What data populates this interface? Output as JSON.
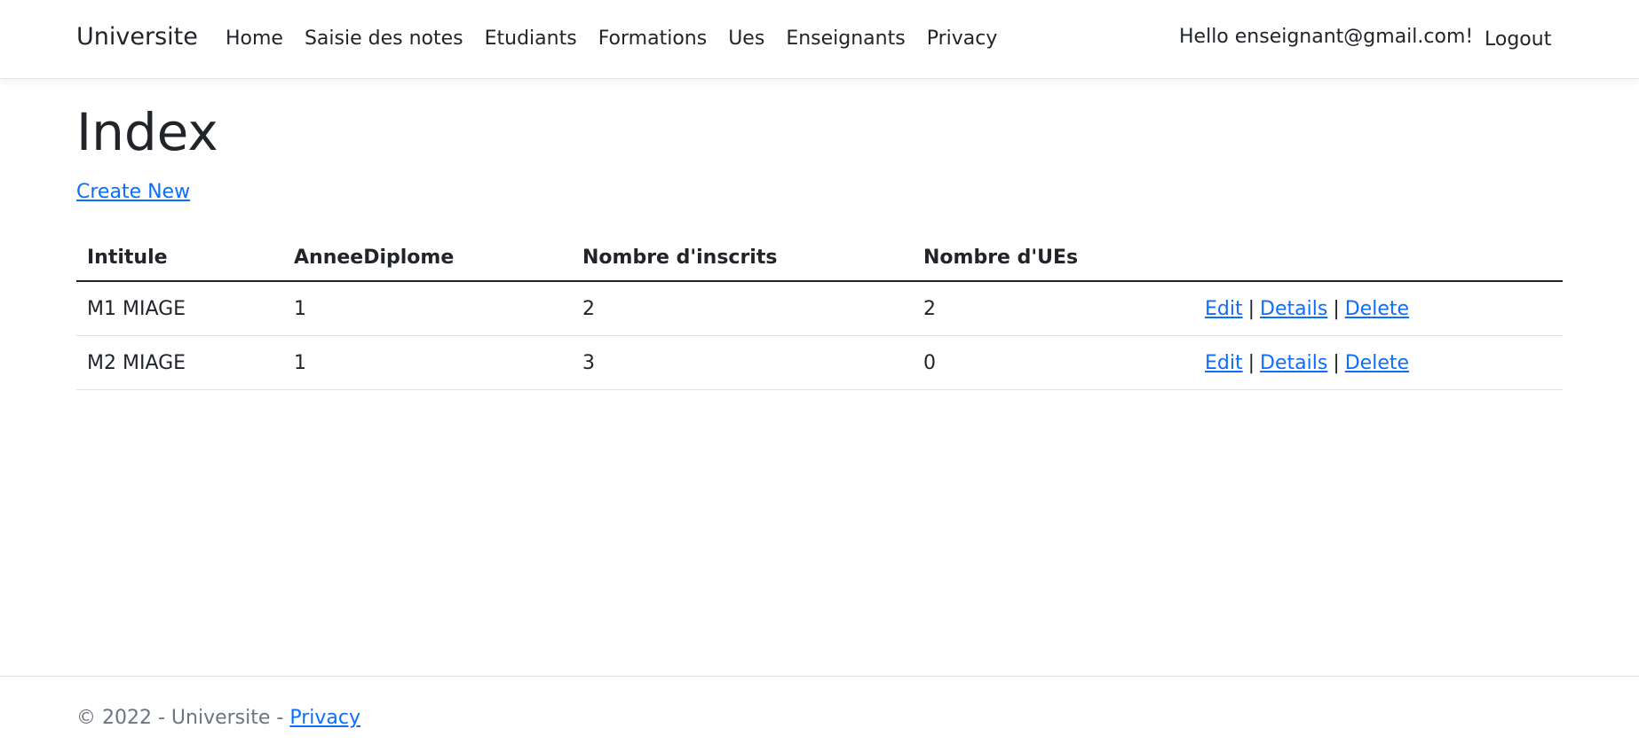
{
  "navbar": {
    "brand": "Universite",
    "links": [
      "Home",
      "Saisie des notes",
      "Etudiants",
      "Formations",
      "Ues",
      "Enseignants",
      "Privacy"
    ],
    "hello": "Hello enseignant@gmail.com!",
    "logout": "Logout"
  },
  "main": {
    "title": "Index",
    "create_new": "Create New",
    "table": {
      "headers": [
        "Intitule",
        "AnneeDiplome",
        "Nombre d'inscrits",
        "Nombre d'UEs",
        ""
      ],
      "rows": [
        {
          "intitule": "M1 MIAGE",
          "annee": "1",
          "inscrits": "2",
          "ues": "2"
        },
        {
          "intitule": "M2 MIAGE",
          "annee": "1",
          "inscrits": "3",
          "ues": "0"
        }
      ],
      "actions": {
        "edit": "Edit",
        "details": "Details",
        "delete": "Delete",
        "separator": "|"
      }
    }
  },
  "footer": {
    "text": "© 2022 - Universite - ",
    "privacy": "Privacy"
  },
  "colors": {
    "link": "#0d6efd",
    "text": "#212529",
    "muted": "#6c757d"
  }
}
